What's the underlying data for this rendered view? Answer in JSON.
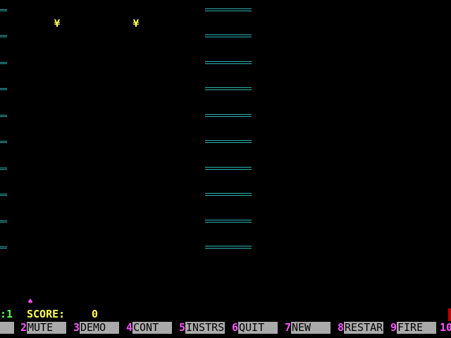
{
  "status": {
    "lives_text": ":1",
    "score_label": "SCORE:",
    "score_value": "0"
  },
  "sprites": {
    "enemy_glyph": "¥",
    "player_glyph": "♠"
  },
  "function_keys": [
    {
      "num": "",
      "label": ""
    },
    {
      "num": "2",
      "label": "MUTE"
    },
    {
      "num": "3",
      "label": "DEMO"
    },
    {
      "num": "4",
      "label": "CONT"
    },
    {
      "num": "5",
      "label": "INSTRS"
    },
    {
      "num": "6",
      "label": "QUIT"
    },
    {
      "num": "7",
      "label": "NEW"
    },
    {
      "num": "8",
      "label": "RESTAR"
    },
    {
      "num": "9",
      "label": "FIRE"
    },
    {
      "num": "10",
      "label": ""
    }
  ],
  "colors": {
    "background": "#000000",
    "rung": "#2fb3b3",
    "enemy": "#ffff55",
    "player": "#ff55ff",
    "lives": "#55ff55",
    "score": "#ffff55",
    "fkey_number": "#ff55ff",
    "fkey_bg": "#aaaaaa"
  }
}
